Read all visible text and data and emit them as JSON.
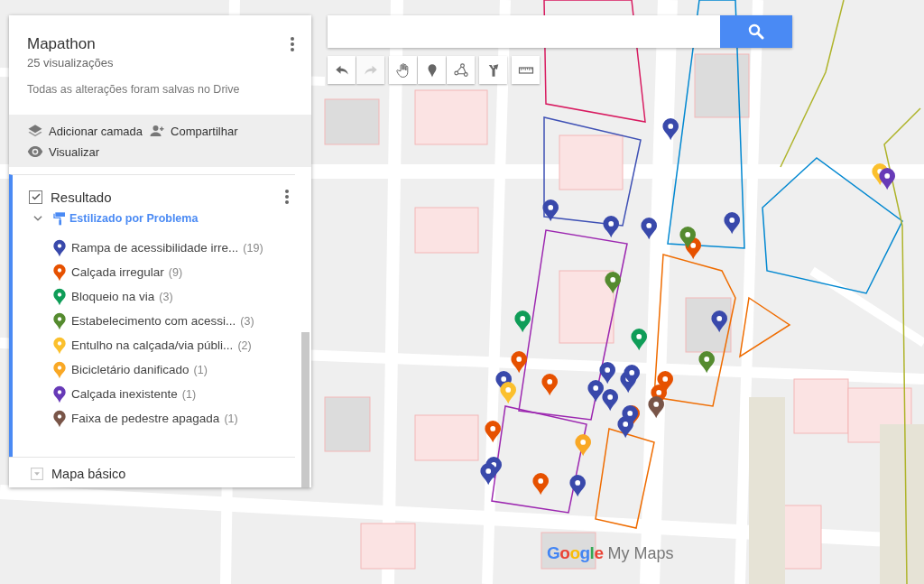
{
  "map": {
    "title": "Mapathon",
    "views": "25 visualizações",
    "save_status": "Todas as alterações foram salvas no Drive"
  },
  "actions": [
    {
      "kind": "layer",
      "label": "Adicionar camada"
    },
    {
      "kind": "share",
      "label": "Compartilhar"
    },
    {
      "kind": "preview",
      "label": "Visualizar"
    }
  ],
  "layer": {
    "name": "Resultado",
    "checked": true,
    "expanded": true,
    "style": "Estilizado por Problema",
    "items": [
      {
        "label": "Rampa de acessibilidade irre...",
        "count": "(19)",
        "color": "#3949ab"
      },
      {
        "label": "Calçada irregular",
        "count": "(9)",
        "color": "#e65100"
      },
      {
        "label": "Bloqueio na via",
        "count": "(3)",
        "color": "#0f9d58"
      },
      {
        "label": "Estabelecimento com acessi...",
        "count": "(3)",
        "color": "#558b2f"
      },
      {
        "label": "Entulho na calçada/via públi...",
        "count": "(2)",
        "color": "#fbc02d"
      },
      {
        "label": "Bicicletário danificado",
        "count": "(1)",
        "color": "#f9a825"
      },
      {
        "label": "Calçada inexistente",
        "count": "(1)",
        "color": "#673ab7"
      },
      {
        "label": "Faixa de pedestre apagada",
        "count": "(1)",
        "color": "#795548"
      }
    ]
  },
  "base_map": {
    "label": "Mapa básico"
  },
  "toolbar": [
    {
      "kind": "undo",
      "disabled": false
    },
    {
      "kind": "redo",
      "disabled": true
    },
    {
      "kind": "hand",
      "disabled": false
    },
    {
      "kind": "marker",
      "disabled": false
    },
    {
      "kind": "line",
      "disabled": false
    },
    {
      "kind": "route",
      "disabled": false
    },
    {
      "kind": "ruler",
      "disabled": false
    }
  ],
  "logo": {
    "brand": "Google",
    "product": "My Maps"
  }
}
